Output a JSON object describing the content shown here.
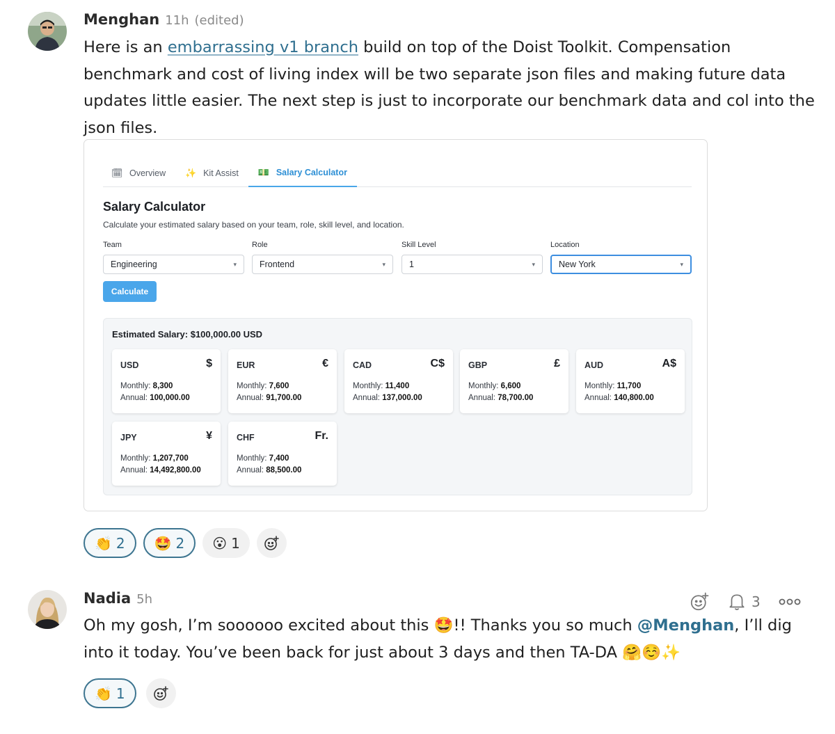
{
  "messages": [
    {
      "author": "Menghan",
      "time": "11h",
      "edited": "(edited)",
      "text_before_link": "Here is an ",
      "link": "embarrassing v1 branch",
      "text_after_link": " build on top of the Doist Toolkit. Compensation benchmark and cost of living index will be two separate json files and making future data updates little easier. The next step is just to incorporate our benchmark data and col into the json files.",
      "reactions": [
        {
          "emoji": "👏",
          "count": "2"
        },
        {
          "emoji": "🤩",
          "count": "2"
        },
        {
          "emoji": "😮",
          "count": "1"
        }
      ]
    },
    {
      "author": "Nadia",
      "time": "5h",
      "text_part1": "Oh my gosh, I’m soooooo excited about this 🤩!! Thanks you so much ",
      "mention": "@Menghan",
      "text_part2": ", I’ll dig into it today. You’ve been back for just about 3 days and then TA-DA 🤗☺️✨",
      "reactions": [
        {
          "emoji": "👏",
          "count": "1"
        }
      ],
      "follow_count": "3"
    }
  ],
  "calculator": {
    "tabs": [
      {
        "label": "Overview",
        "icon": "🗓"
      },
      {
        "label": "Kit Assist",
        "icon": "✨"
      },
      {
        "label": "Salary Calculator",
        "icon": "💵"
      }
    ],
    "title": "Salary Calculator",
    "description": "Calculate your estimated salary based on your team, role, skill level, and location.",
    "fields": [
      {
        "label": "Team",
        "value": "Engineering"
      },
      {
        "label": "Role",
        "value": "Frontend"
      },
      {
        "label": "Skill Level",
        "value": "1"
      },
      {
        "label": "Location",
        "value": "New York"
      }
    ],
    "calculate_label": "Calculate",
    "estimate": "Estimated Salary: $100,000.00 USD",
    "monthly_label": "Monthly:",
    "annual_label": "Annual:",
    "currencies": [
      {
        "code": "USD",
        "symbol": "$",
        "monthly": "8,300",
        "annual": "100,000.00"
      },
      {
        "code": "EUR",
        "symbol": "€",
        "monthly": "7,600",
        "annual": "91,700.00"
      },
      {
        "code": "CAD",
        "symbol": "C$",
        "monthly": "11,400",
        "annual": "137,000.00"
      },
      {
        "code": "GBP",
        "symbol": "£",
        "monthly": "6,600",
        "annual": "78,700.00"
      },
      {
        "code": "AUD",
        "symbol": "A$",
        "monthly": "11,700",
        "annual": "140,800.00"
      },
      {
        "code": "JPY",
        "symbol": "¥",
        "monthly": "1,207,700",
        "annual": "14,492,800.00"
      },
      {
        "code": "CHF",
        "symbol": "Fr.",
        "monthly": "7,400",
        "annual": "88,500.00"
      }
    ]
  },
  "icons": {
    "add_reaction": "add-reaction-icon",
    "bell": "bell-icon",
    "more": "more-icon"
  },
  "colors": {
    "link": "#2f6f8f",
    "accent": "#4aa6ea"
  }
}
